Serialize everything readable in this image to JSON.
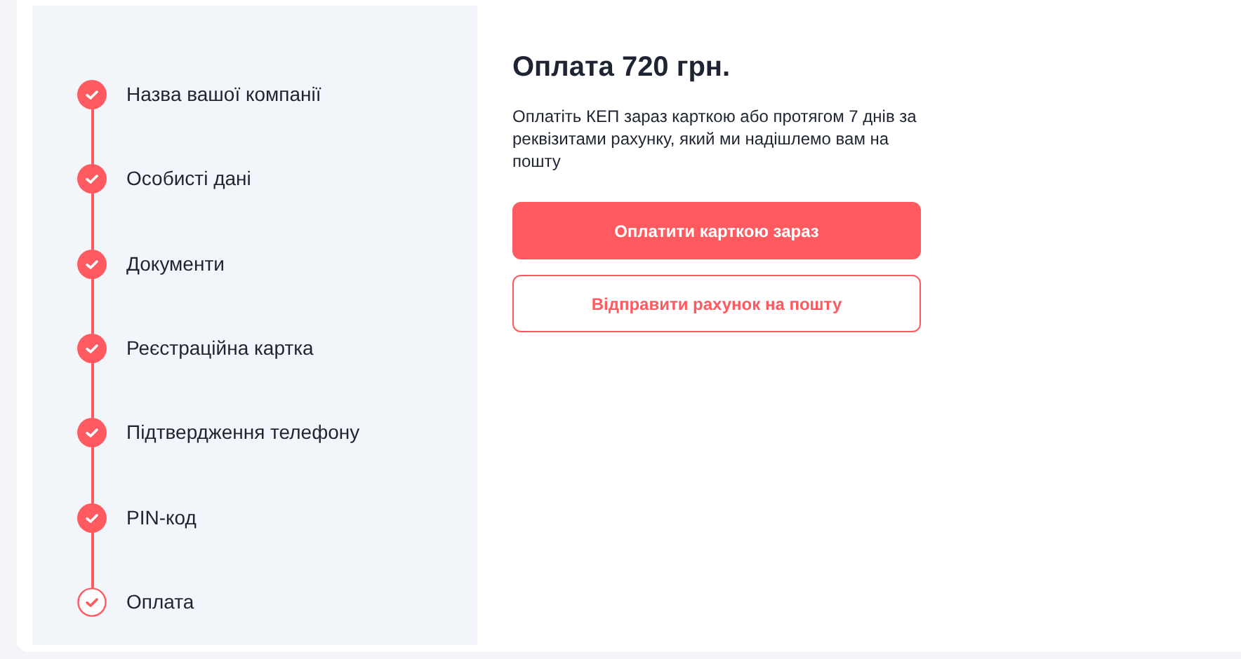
{
  "steps": [
    {
      "label": "Назва вашої компанії",
      "completed": true
    },
    {
      "label": "Особисті дані",
      "completed": true
    },
    {
      "label": "Документи",
      "completed": true
    },
    {
      "label": "Реєстраційна картка",
      "completed": true
    },
    {
      "label": "Підтвердження телефону",
      "completed": true
    },
    {
      "label": "PIN-код",
      "completed": true
    },
    {
      "label": "Оплата",
      "completed": false
    }
  ],
  "payment": {
    "title": "Оплата 720 грн.",
    "description": "Оплатіть КЕП зараз карткою або протягом 7 днів за реквізитами рахунку, який ми надішлемо вам на пошту",
    "buttons": [
      {
        "label": "Оплатити карткою зараз",
        "kind": "primary"
      },
      {
        "label": "Відправити рахунок на пошту",
        "kind": "outline"
      }
    ]
  }
}
